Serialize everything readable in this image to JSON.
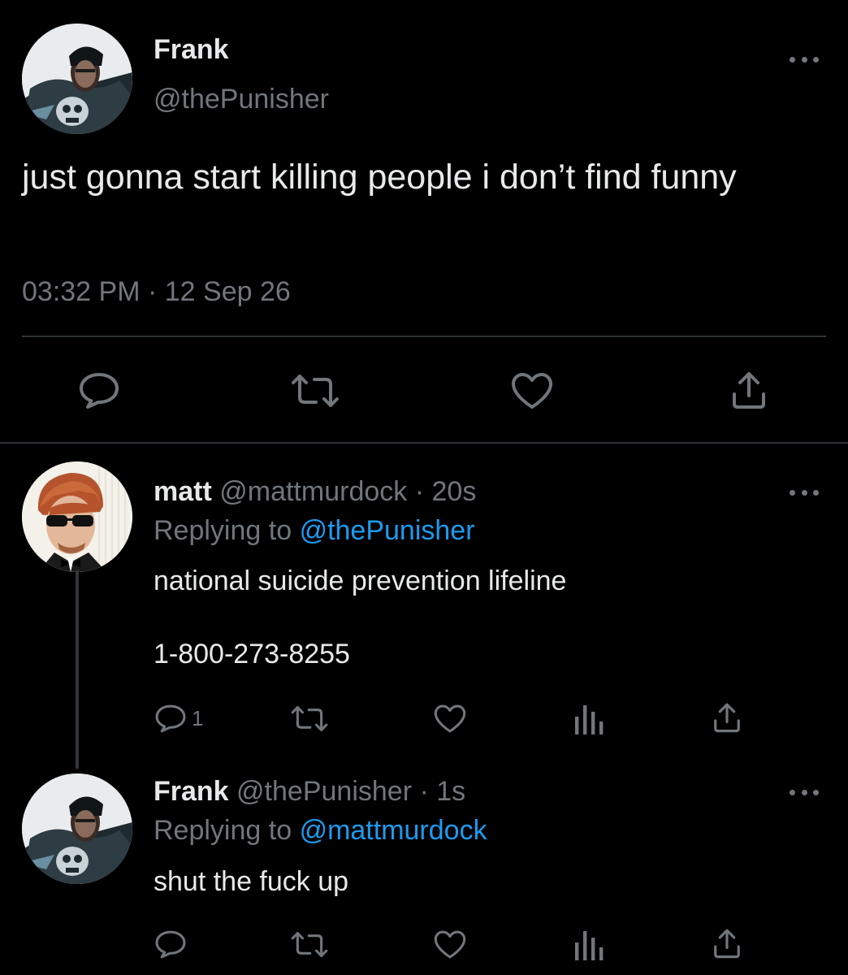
{
  "colors": {
    "background": "#000000",
    "text": "#e7e9ea",
    "secondary": "#71767b",
    "link": "#1d9bf0",
    "divider": "#2f3336"
  },
  "main_tweet": {
    "display_name": "Frank",
    "handle": "@thePunisher",
    "text": "just gonna start killing people i don’t find funny",
    "time": "03:32 PM",
    "separator": "·",
    "date": "12 Sep 26",
    "actions": [
      "reply-icon",
      "retweet-icon",
      "like-icon",
      "share-icon"
    ],
    "more_icon": "more-horizontal-icon"
  },
  "replies": [
    {
      "display_name": "matt",
      "handle": "@mattmurdock",
      "separator": "·",
      "time": "20s",
      "replying_prefix": "Replying to",
      "replying_to": "@thePunisher",
      "text_line1": "national suicide prevention lifeline",
      "text_line2": "1-800-273-8255",
      "reply_count": "1",
      "actions": [
        "reply-icon",
        "retweet-icon",
        "like-icon",
        "analytics-icon",
        "share-icon"
      ]
    },
    {
      "display_name": "Frank",
      "handle": "@thePunisher",
      "separator": "·",
      "time": "1s",
      "replying_prefix": "Replying to",
      "replying_to": "@mattmurdock",
      "text": "shut the fuck up",
      "actions": [
        "reply-icon",
        "retweet-icon",
        "like-icon",
        "analytics-icon",
        "share-icon"
      ]
    }
  ]
}
